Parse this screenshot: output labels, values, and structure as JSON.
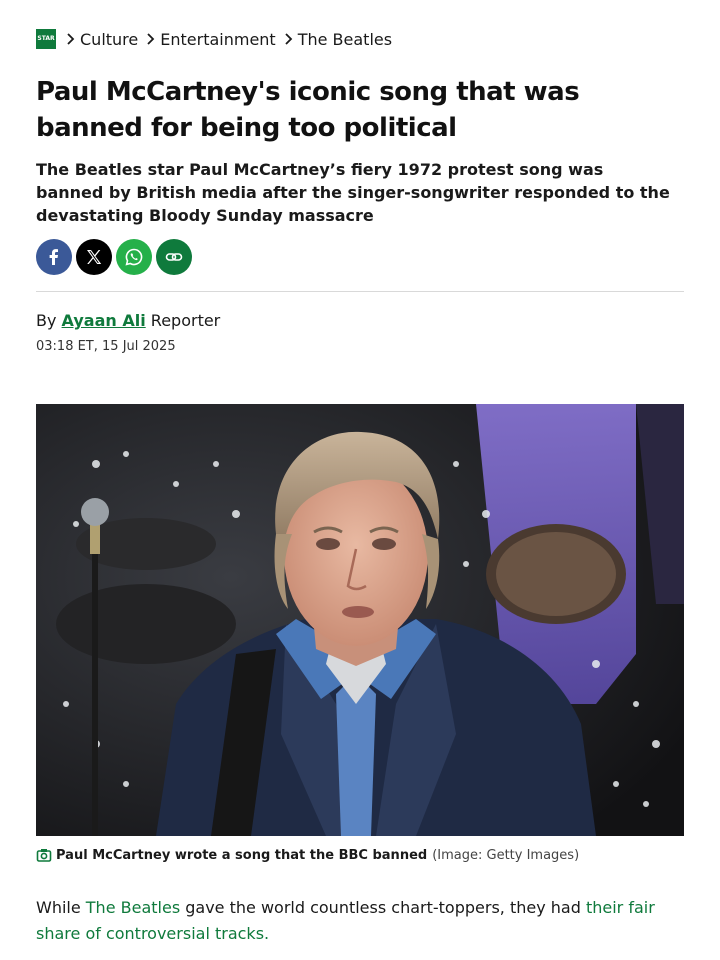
{
  "breadcrumb": {
    "logo_text": "STAR",
    "items": [
      "Culture",
      "Entertainment",
      "The Beatles"
    ]
  },
  "article": {
    "headline": "Paul McCartney's iconic song that was banned for being too political",
    "standfirst": "The Beatles star Paul McCartney’s fiery 1972 protest song was banned by British media after the singer-songwriter responded to the devastating Bloody Sunday massacre",
    "byline_prefix": "By",
    "author": "Ayaan Ali",
    "author_role": "Reporter",
    "date": "03:18 ET, 15 Jul 2025",
    "caption": "Paul McCartney wrote a song that the BBC banned",
    "caption_credit": "(Image: Getty Images)",
    "body": {
      "part1": "While ",
      "link1": "The Beatles",
      "part2": " gave the world countless chart-toppers, they had ",
      "link2": "their fair share of controversial tracks."
    }
  },
  "share": {
    "icons": [
      "facebook-icon",
      "x-icon",
      "whatsapp-icon",
      "link-icon"
    ]
  },
  "colors": {
    "accent": "#0f7a3c",
    "facebook": "#3b5998",
    "whatsapp": "#25b04a"
  }
}
